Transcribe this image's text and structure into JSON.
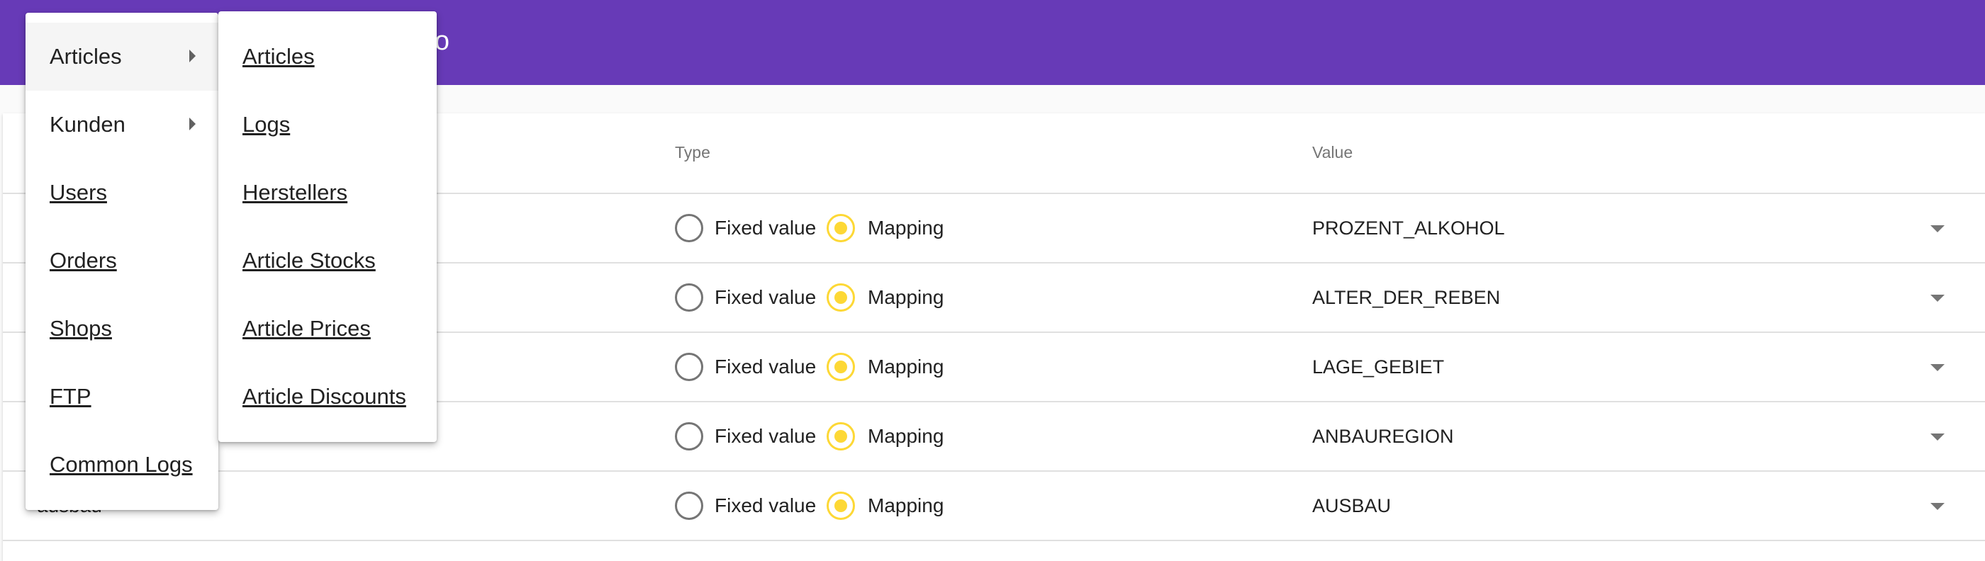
{
  "app": {
    "title_fragment": "ento"
  },
  "table": {
    "headers": {
      "type": "Type",
      "value": "Value"
    },
    "rows": [
      {
        "name": "",
        "option_fixed": "Fixed value",
        "option_mapping": "Mapping",
        "selected": "Mapping",
        "value": "PROZENT_ALKOHOL"
      },
      {
        "name": "",
        "option_fixed": "Fixed value",
        "option_mapping": "Mapping",
        "selected": "Mapping",
        "value": "ALTER_DER_REBEN"
      },
      {
        "name": "",
        "option_fixed": "Fixed value",
        "option_mapping": "Mapping",
        "selected": "Mapping",
        "value": "LAGE_GEBIET"
      },
      {
        "name": "",
        "option_fixed": "Fixed value",
        "option_mapping": "Mapping",
        "selected": "Mapping",
        "value": "ANBAUREGION"
      },
      {
        "name": "ausbau",
        "option_fixed": "Fixed value",
        "option_mapping": "Mapping",
        "selected": "Mapping",
        "value": "AUSBAU"
      }
    ]
  },
  "main_menu": {
    "items": [
      {
        "label": "Articles",
        "has_submenu": true
      },
      {
        "label": "Kunden",
        "has_submenu": true
      },
      {
        "label": "Users"
      },
      {
        "label": "Orders"
      },
      {
        "label": "Shops"
      },
      {
        "label": "FTP"
      },
      {
        "label": "Common Logs"
      }
    ]
  },
  "sub_menu": {
    "items": [
      {
        "label": "Articles"
      },
      {
        "label": "Logs"
      },
      {
        "label": "Herstellers"
      },
      {
        "label": "Article Stocks"
      },
      {
        "label": "Article Prices"
      },
      {
        "label": "Article Discounts"
      }
    ]
  },
  "colors": {
    "toolbar": "#673ab7",
    "accent": "#fdd835"
  }
}
